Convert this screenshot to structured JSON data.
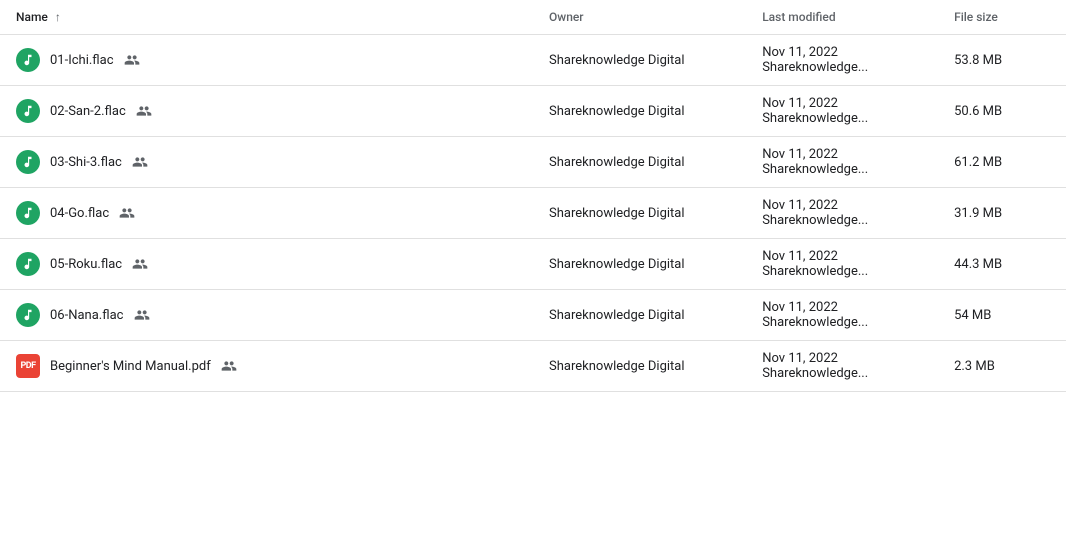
{
  "table": {
    "headers": {
      "name": "Name",
      "sort_arrow": "↑",
      "owner": "Owner",
      "last_modified": "Last modified",
      "file_size": "File size"
    },
    "rows": [
      {
        "id": 1,
        "icon_type": "audio",
        "name": "01-Ichi.flac",
        "owner": "Shareknowledge Digital",
        "modified": "Nov 11, 2022 Shareknowledge...",
        "size": "53.8 MB"
      },
      {
        "id": 2,
        "icon_type": "audio",
        "name": "02-San-2.flac",
        "owner": "Shareknowledge Digital",
        "modified": "Nov 11, 2022 Shareknowledge...",
        "size": "50.6 MB"
      },
      {
        "id": 3,
        "icon_type": "audio",
        "name": "03-Shi-3.flac",
        "owner": "Shareknowledge Digital",
        "modified": "Nov 11, 2022 Shareknowledge...",
        "size": "61.2 MB"
      },
      {
        "id": 4,
        "icon_type": "audio",
        "name": "04-Go.flac",
        "owner": "Shareknowledge Digital",
        "modified": "Nov 11, 2022 Shareknowledge...",
        "size": "31.9 MB"
      },
      {
        "id": 5,
        "icon_type": "audio",
        "name": "05-Roku.flac",
        "owner": "Shareknowledge Digital",
        "modified": "Nov 11, 2022 Shareknowledge...",
        "size": "44.3 MB"
      },
      {
        "id": 6,
        "icon_type": "audio",
        "name": "06-Nana.flac",
        "owner": "Shareknowledge Digital",
        "modified": "Nov 11, 2022 Shareknowledge...",
        "size": "54 MB"
      },
      {
        "id": 7,
        "icon_type": "pdf",
        "name": "Beginner's Mind Manual.pdf",
        "owner": "Shareknowledge Digital",
        "modified": "Nov 11, 2022 Shareknowledge...",
        "size": "2.3 MB"
      }
    ]
  }
}
